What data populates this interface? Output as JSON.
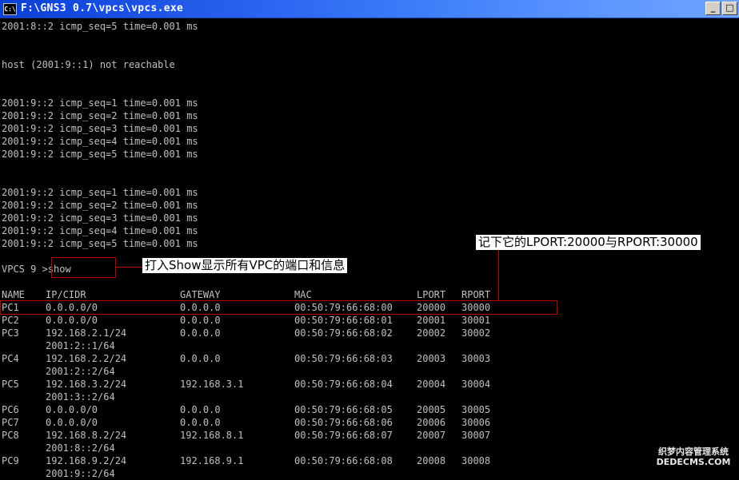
{
  "window": {
    "title": "F:\\GNS3 0.7\\vpcs\\vpcs.exe",
    "icon_text": "C:\\"
  },
  "console": {
    "lines": [
      "2001:8::2 icmp_seq=5 time=0.001 ms",
      "host (2001:9::1) not reachable",
      "2001:9::2 icmp_seq=1 time=0.001 ms",
      "2001:9::2 icmp_seq=2 time=0.001 ms",
      "2001:9::2 icmp_seq=3 time=0.001 ms",
      "2001:9::2 icmp_seq=4 time=0.001 ms",
      "2001:9::2 icmp_seq=5 time=0.001 ms",
      "2001:9::2 icmp_seq=1 time=0.001 ms",
      "2001:9::2 icmp_seq=2 time=0.001 ms",
      "2001:9::2 icmp_seq=3 time=0.001 ms",
      "2001:9::2 icmp_seq=4 time=0.001 ms",
      "2001:9::2 icmp_seq=5 time=0.001 ms",
      "VPCS 9 >show"
    ],
    "table": {
      "headers": [
        "NAME",
        "IP/CIDR",
        "GATEWAY",
        "MAC",
        "LPORT",
        "RPORT"
      ],
      "rows": [
        [
          "PC1",
          "0.0.0.0/0",
          "0.0.0.0",
          "00:50:79:66:68:00",
          "20000",
          "30000"
        ],
        [
          "PC2",
          "0.0.0.0/0",
          "0.0.0.0",
          "00:50:79:66:68:01",
          "20001",
          "30001"
        ],
        [
          "PC3",
          "192.168.2.1/24",
          "0.0.0.0",
          "00:50:79:66:68:02",
          "20002",
          "30002"
        ],
        [
          "",
          "2001:2::1/64",
          "",
          "",
          "",
          ""
        ],
        [
          "PC4",
          "192.168.2.2/24",
          "0.0.0.0",
          "00:50:79:66:68:03",
          "20003",
          "30003"
        ],
        [
          "",
          "2001:2::2/64",
          "",
          "",
          "",
          ""
        ],
        [
          "PC5",
          "192.168.3.2/24",
          "192.168.3.1",
          "00:50:79:66:68:04",
          "20004",
          "30004"
        ],
        [
          "",
          "2001:3::2/64",
          "",
          "",
          "",
          ""
        ],
        [
          "PC6",
          "0.0.0.0/0",
          "0.0.0.0",
          "00:50:79:66:68:05",
          "20005",
          "30005"
        ],
        [
          "PC7",
          "0.0.0.0/0",
          "0.0.0.0",
          "00:50:79:66:68:06",
          "20006",
          "30006"
        ],
        [
          "PC8",
          "192.168.8.2/24",
          "192.168.8.1",
          "00:50:79:66:68:07",
          "20007",
          "30007"
        ],
        [
          "",
          "2001:8::2/64",
          "",
          "",
          "",
          ""
        ],
        [
          "PC9",
          "192.168.9.2/24",
          "192.168.9.1",
          "00:50:79:66:68:08",
          "20008",
          "30008"
        ],
        [
          "",
          "2001:9::2/64",
          "",
          "",
          "",
          ""
        ]
      ]
    }
  },
  "annotations": {
    "show_note": "打入Show显示所有VPC的端口和信息",
    "port_note": "记下它的LPORT:20000与RPORT:30000",
    "color": "#c00000"
  },
  "watermark": {
    "line1": "织梦内容管理系统",
    "line2": "DEDECMS.COM"
  }
}
